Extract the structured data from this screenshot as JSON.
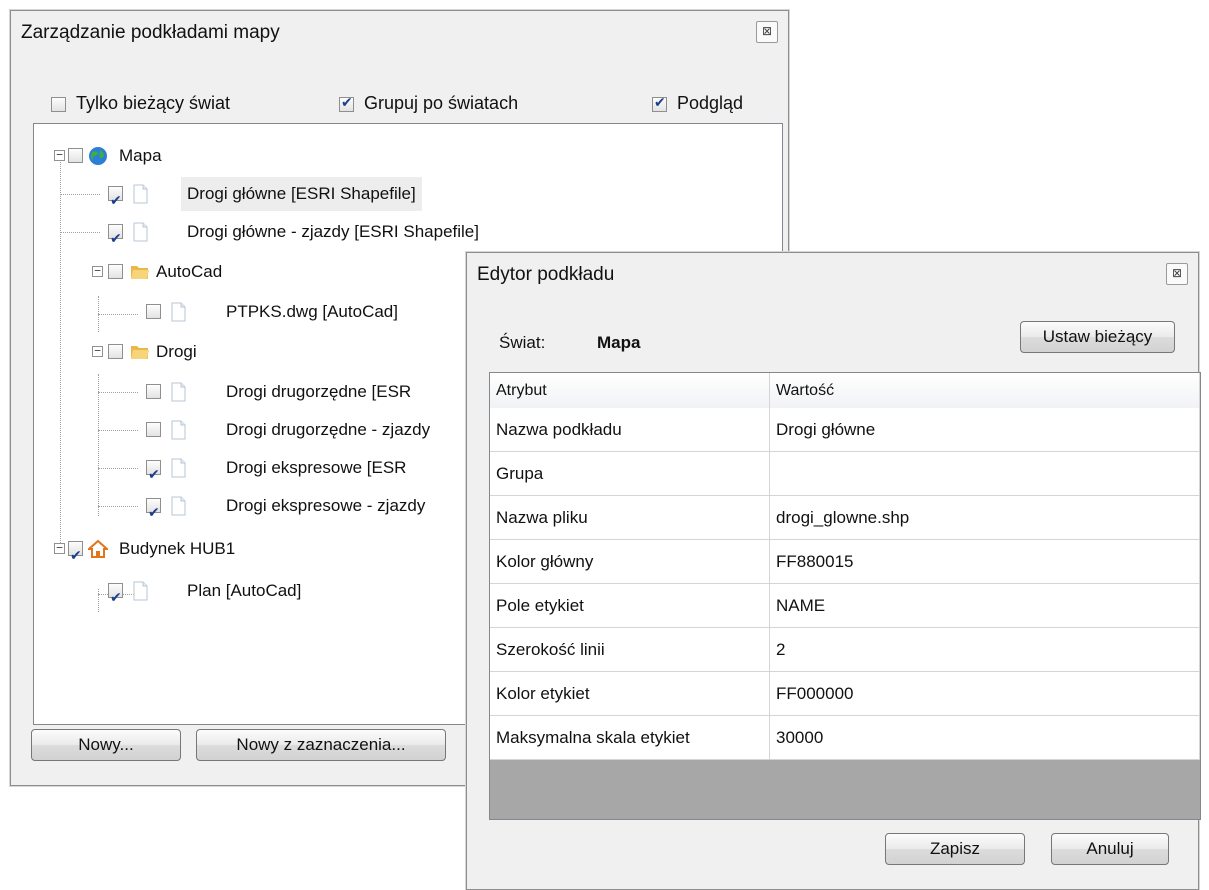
{
  "main_window": {
    "title": "Zarządzanie podkładami mapy",
    "close_glyph": "⊠",
    "options": [
      {
        "label": "Tylko bieżący świat",
        "checked": false
      },
      {
        "label": "Grupuj po światach",
        "checked": true
      },
      {
        "label": "Podgląd",
        "checked": true
      }
    ],
    "tree": [
      {
        "label": "Mapa",
        "checked": false,
        "icon": "globe-icon"
      },
      {
        "label": "Drogi główne   [ESRI Shapefile]",
        "checked": true,
        "icon": "file-icon"
      },
      {
        "label": "Drogi główne - zjazdy   [ESRI Shapefile]",
        "checked": true,
        "icon": "file-icon"
      },
      {
        "label": "AutoCad",
        "checked": false,
        "icon": "folder-icon"
      },
      {
        "label": "PTPKS.dwg   [AutoCad]",
        "checked": false,
        "icon": "file-icon"
      },
      {
        "label": "Drogi",
        "checked": false,
        "icon": "folder-icon"
      },
      {
        "label": "Drogi drugorzędne   [ESR",
        "checked": false,
        "icon": "file-icon"
      },
      {
        "label": "Drogi drugorzędne - zjazdy",
        "checked": false,
        "icon": "file-icon"
      },
      {
        "label": "Drogi ekspresowe   [ESR",
        "checked": true,
        "icon": "file-icon"
      },
      {
        "label": "Drogi ekspresowe - zjazdy",
        "checked": true,
        "icon": "file-icon"
      },
      {
        "label": "Budynek HUB1",
        "checked": true,
        "icon": "house-icon"
      },
      {
        "label": "Plan   [AutoCad]",
        "checked": true,
        "icon": "file-icon"
      }
    ],
    "buttons": {
      "new": "Nowy...",
      "new_from_selection": "Nowy z zaznaczenia..."
    }
  },
  "editor_window": {
    "title": "Edytor podkładu",
    "close_glyph": "⊠",
    "world_label": "Świat:",
    "world_value": "Mapa",
    "set_current_button": "Ustaw bieżący",
    "columns": [
      "Atrybut",
      "Wartość"
    ],
    "rows": [
      [
        "Nazwa podkładu",
        "Drogi główne"
      ],
      [
        "Grupa",
        ""
      ],
      [
        "Nazwa pliku",
        "drogi_glowne.shp"
      ],
      [
        "Kolor główny",
        "FF880015"
      ],
      [
        "Pole etykiet",
        "NAME"
      ],
      [
        "Szerokość linii",
        "2"
      ],
      [
        "Kolor etykiet",
        "FF000000"
      ],
      [
        "Maksymalna skala etykiet",
        "30000"
      ]
    ],
    "buttons": {
      "save": "Zapisz",
      "cancel": "Anuluj"
    }
  }
}
